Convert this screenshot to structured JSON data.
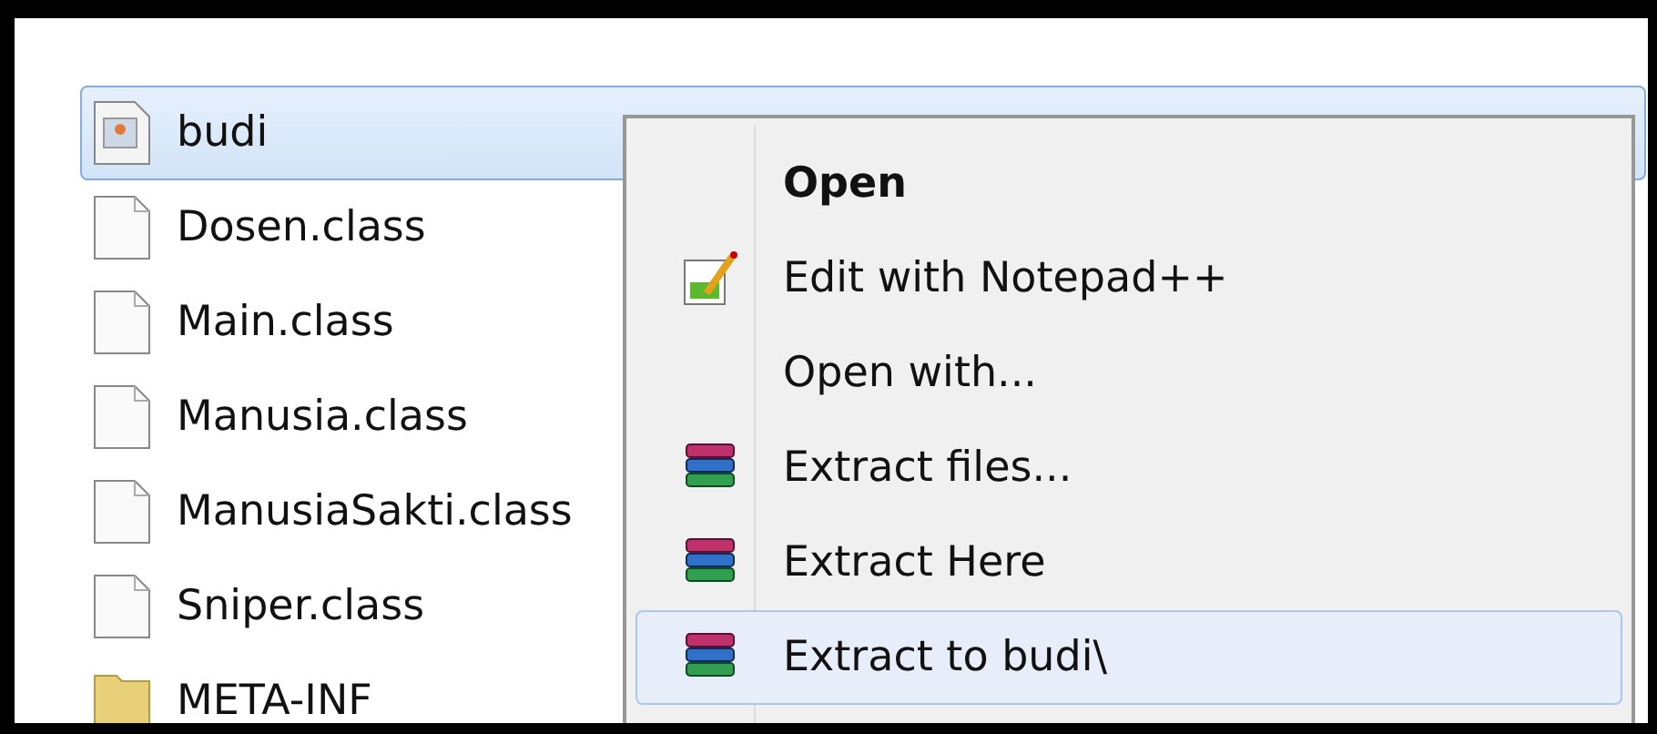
{
  "files": [
    {
      "name": "budi",
      "kind": "image",
      "selected": true
    },
    {
      "name": "Dosen.class",
      "kind": "file",
      "selected": false
    },
    {
      "name": "Main.class",
      "kind": "file",
      "selected": false
    },
    {
      "name": "Manusia.class",
      "kind": "file",
      "selected": false
    },
    {
      "name": "ManusiaSakti.class",
      "kind": "file",
      "selected": false
    },
    {
      "name": "Sniper.class",
      "kind": "file",
      "selected": false
    },
    {
      "name": "META-INF",
      "kind": "folder",
      "selected": false
    }
  ],
  "context_menu": {
    "items": [
      {
        "label": "Open",
        "kind": "plain",
        "default": true,
        "selected": false
      },
      {
        "label": "Edit with Notepad++",
        "kind": "notepad",
        "default": false,
        "selected": false
      },
      {
        "label": "Open with...",
        "kind": "plain",
        "default": false,
        "selected": false
      },
      {
        "label": "Extract files...",
        "kind": "archive",
        "default": false,
        "selected": false
      },
      {
        "label": "Extract Here",
        "kind": "archive",
        "default": false,
        "selected": false
      },
      {
        "label": "Extract to budi\\",
        "kind": "archive",
        "default": false,
        "selected": true
      }
    ]
  }
}
